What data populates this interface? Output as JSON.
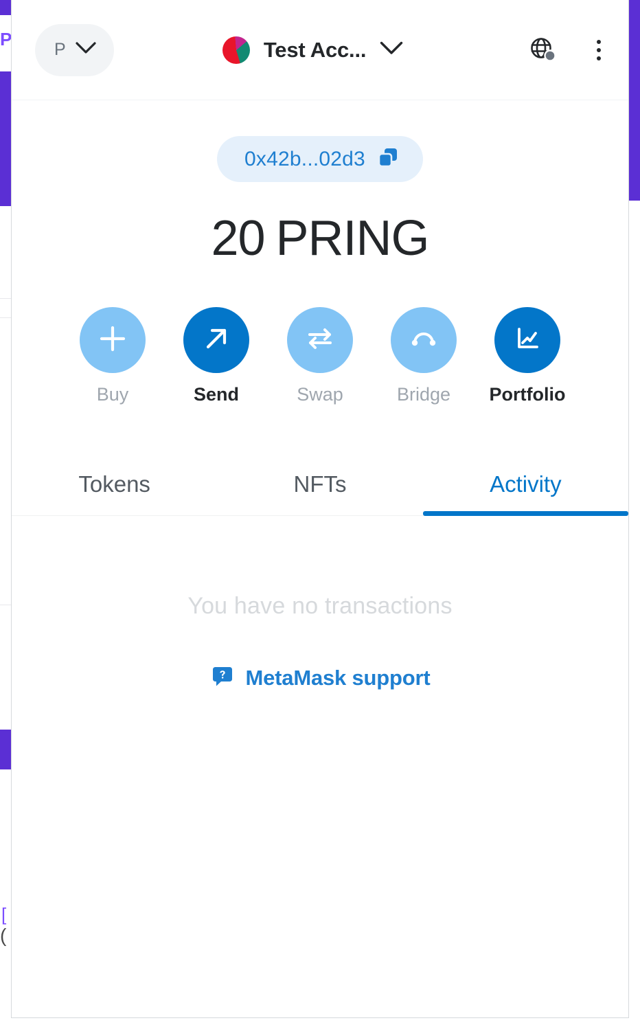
{
  "background": {
    "accent_color": "#5b2fd4",
    "label_p": "P",
    "bracket_text": "[",
    "paren_text": "("
  },
  "header": {
    "network_selector": {
      "avatar_initial": "P",
      "chevron_icon": "chevron-down-icon"
    },
    "account": {
      "name": "Test Acc...",
      "avatar_icon": "jazzicon-avatar",
      "chevron_icon": "chevron-down-icon"
    },
    "actions": {
      "connection_status_icon": "global-connection-icon",
      "menu_icon": "kebab-menu-icon"
    }
  },
  "overview": {
    "address": "0x42b...02d3",
    "copy_icon": "copy-icon",
    "balance": {
      "amount": "20",
      "symbol": "PRING"
    }
  },
  "actions": [
    {
      "label": "Buy",
      "icon": "plus-icon",
      "enabled": false
    },
    {
      "label": "Send",
      "icon": "arrow-up-right-icon",
      "enabled": true
    },
    {
      "label": "Swap",
      "icon": "swap-arrows-icon",
      "enabled": false
    },
    {
      "label": "Bridge",
      "icon": "bridge-arc-icon",
      "enabled": false
    },
    {
      "label": "Portfolio",
      "icon": "line-chart-icon",
      "enabled": true
    }
  ],
  "tabs": [
    {
      "label": "Tokens",
      "active": false
    },
    {
      "label": "NFTs",
      "active": false
    },
    {
      "label": "Activity",
      "active": true
    }
  ],
  "activity": {
    "empty_text": "You have no transactions",
    "support_link": "MetaMask support",
    "support_icon": "question-speech-bubble-icon"
  },
  "colors": {
    "primary": "#0376c9",
    "link": "#1f7fd0",
    "disabled_blue": "#82c4f5",
    "muted": "#d6d9dc"
  }
}
